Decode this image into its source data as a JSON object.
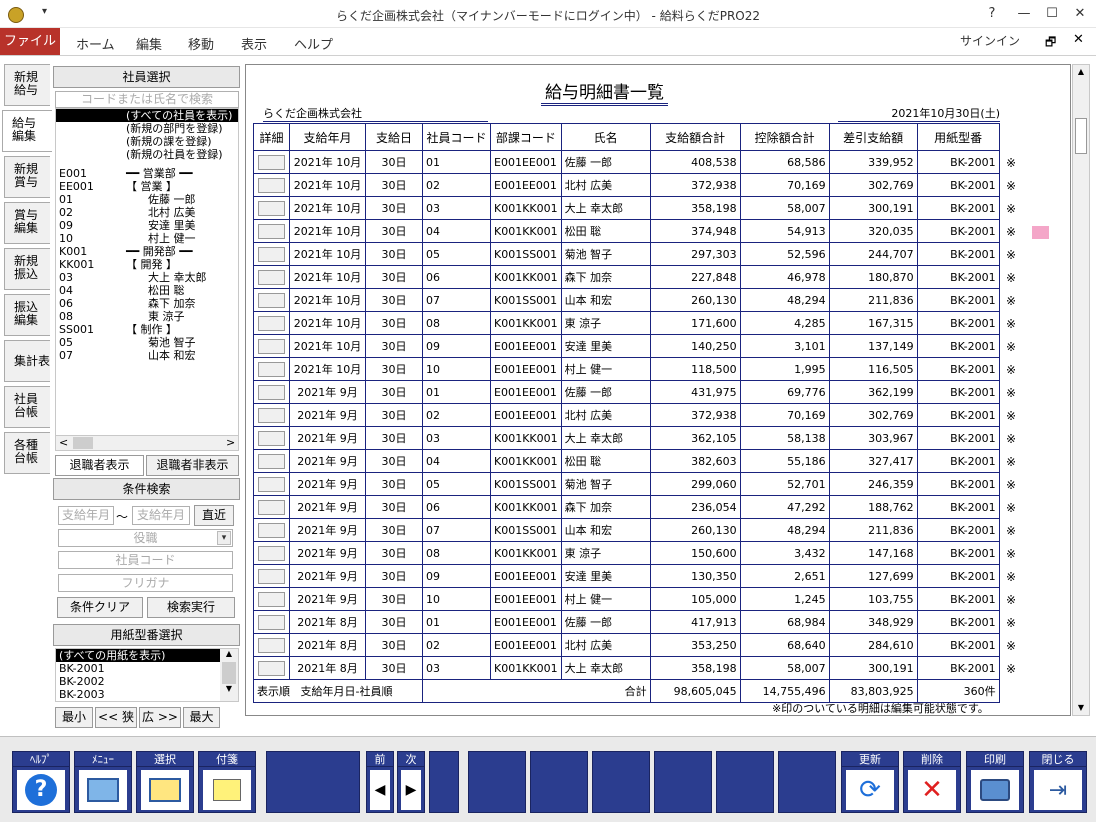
{
  "window": {
    "title": "らくだ企画株式会社（マイナンバーモードにログイン中） - 給料らくだPRO22",
    "qat": "▾",
    "help": "?",
    "minimize": "—",
    "maximize": "☐",
    "close": "✕"
  },
  "ribbon": {
    "file": "ファイル",
    "tabs": [
      "ホーム",
      "編集",
      "移動",
      "表示",
      "ヘルプ"
    ],
    "signin": "サインイン",
    "restore": "🗗",
    "close2": "✕"
  },
  "vtabs": [
    [
      "新規",
      "給与"
    ],
    [
      "給与",
      "編集"
    ],
    [
      "新規",
      "賞与"
    ],
    [
      "賞与",
      "編集"
    ],
    [
      "新規",
      "振込"
    ],
    [
      "振込",
      "編集"
    ],
    [
      "集計表",
      ""
    ],
    [
      "社員",
      "台帳"
    ],
    [
      "各種",
      "台帳"
    ]
  ],
  "emp": {
    "header": "社員選択",
    "search_placeholder": "コードまたは氏名で検索",
    "tree": [
      [
        "",
        "(すべての社員を表示)"
      ],
      [
        "",
        "(新規の部門を登録)"
      ],
      [
        "",
        "(新規の課を登録)"
      ],
      [
        "",
        "(新規の社員を登録)"
      ],
      [
        "E001",
        "━━ 営業部 ━━"
      ],
      [
        "EE001",
        "【 営業 】"
      ],
      [
        "01",
        "　　佐藤 一郎"
      ],
      [
        "02",
        "　　北村 広美"
      ],
      [
        "09",
        "　　安達 里美"
      ],
      [
        "10",
        "　　村上 健一"
      ],
      [
        "K001",
        "━━ 開発部 ━━"
      ],
      [
        "KK001",
        "【 開発 】"
      ],
      [
        "03",
        "　　大上 幸太郎"
      ],
      [
        "04",
        "　　松田 聡"
      ],
      [
        "06",
        "　　森下 加奈"
      ],
      [
        "08",
        "　　東 涼子"
      ],
      [
        "SS001",
        "【 制作 】"
      ],
      [
        "05",
        "　　菊池 智子"
      ],
      [
        "07",
        "　　山本 和宏"
      ]
    ],
    "retired_show": "退職者表示",
    "retired_hide": "退職者非表示",
    "cond_header": "条件検索",
    "pay_ym_from": "支給年月",
    "tilde": "～",
    "pay_ym_to": "支給年月",
    "recent": "直近",
    "position": "役職",
    "emp_code": "社員コード",
    "furigana": "フリガナ",
    "clear": "条件クリア",
    "exec": "検索実行",
    "paper_header": "用紙型番選択",
    "papers": [
      "(すべての用紙を表示)",
      "BK-2001",
      "BK-2002",
      "BK-2003"
    ],
    "nav": [
      "最小",
      "<< 狭",
      "広 >>",
      "最大"
    ]
  },
  "main": {
    "title": "給与明細書一覧",
    "company": "らくだ企画株式会社",
    "date": "2021年10月30日(土)",
    "columns": [
      "詳細",
      "支給年月",
      "支給日",
      "社員コード",
      "部課コード",
      "氏名",
      "支給額合計",
      "控除額合計",
      "差引支給額",
      "用紙型番"
    ],
    "rows": [
      [
        "2021年 10月",
        "30日",
        "01",
        "E001EE001",
        "佐藤 一郎",
        "408,538",
        "68,586",
        "339,952",
        "BK-2001"
      ],
      [
        "2021年 10月",
        "30日",
        "02",
        "E001EE001",
        "北村 広美",
        "372,938",
        "70,169",
        "302,769",
        "BK-2001"
      ],
      [
        "2021年 10月",
        "30日",
        "03",
        "K001KK001",
        "大上 幸太郎",
        "358,198",
        "58,007",
        "300,191",
        "BK-2001"
      ],
      [
        "2021年 10月",
        "30日",
        "04",
        "K001KK001",
        "松田 聡",
        "374,948",
        "54,913",
        "320,035",
        "BK-2001"
      ],
      [
        "2021年 10月",
        "30日",
        "05",
        "K001SS001",
        "菊池 智子",
        "297,303",
        "52,596",
        "244,707",
        "BK-2001"
      ],
      [
        "2021年 10月",
        "30日",
        "06",
        "K001KK001",
        "森下 加奈",
        "227,848",
        "46,978",
        "180,870",
        "BK-2001"
      ],
      [
        "2021年 10月",
        "30日",
        "07",
        "K001SS001",
        "山本 和宏",
        "260,130",
        "48,294",
        "211,836",
        "BK-2001"
      ],
      [
        "2021年 10月",
        "30日",
        "08",
        "K001KK001",
        "東 涼子",
        "171,600",
        "4,285",
        "167,315",
        "BK-2001"
      ],
      [
        "2021年 10月",
        "30日",
        "09",
        "E001EE001",
        "安達 里美",
        "140,250",
        "3,101",
        "137,149",
        "BK-2001"
      ],
      [
        "2021年 10月",
        "30日",
        "10",
        "E001EE001",
        "村上 健一",
        "118,500",
        "1,995",
        "116,505",
        "BK-2001"
      ],
      [
        "2021年 9月",
        "30日",
        "01",
        "E001EE001",
        "佐藤 一郎",
        "431,975",
        "69,776",
        "362,199",
        "BK-2001"
      ],
      [
        "2021年 9月",
        "30日",
        "02",
        "E001EE001",
        "北村 広美",
        "372,938",
        "70,169",
        "302,769",
        "BK-2001"
      ],
      [
        "2021年 9月",
        "30日",
        "03",
        "K001KK001",
        "大上 幸太郎",
        "362,105",
        "58,138",
        "303,967",
        "BK-2001"
      ],
      [
        "2021年 9月",
        "30日",
        "04",
        "K001KK001",
        "松田 聡",
        "382,603",
        "55,186",
        "327,417",
        "BK-2001"
      ],
      [
        "2021年 9月",
        "30日",
        "05",
        "K001SS001",
        "菊池 智子",
        "299,060",
        "52,701",
        "246,359",
        "BK-2001"
      ],
      [
        "2021年 9月",
        "30日",
        "06",
        "K001KK001",
        "森下 加奈",
        "236,054",
        "47,292",
        "188,762",
        "BK-2001"
      ],
      [
        "2021年 9月",
        "30日",
        "07",
        "K001SS001",
        "山本 和宏",
        "260,130",
        "48,294",
        "211,836",
        "BK-2001"
      ],
      [
        "2021年 9月",
        "30日",
        "08",
        "K001KK001",
        "東 涼子",
        "150,600",
        "3,432",
        "147,168",
        "BK-2001"
      ],
      [
        "2021年 9月",
        "30日",
        "09",
        "E001EE001",
        "安達 里美",
        "130,350",
        "2,651",
        "127,699",
        "BK-2001"
      ],
      [
        "2021年 9月",
        "30日",
        "10",
        "E001EE001",
        "村上 健一",
        "105,000",
        "1,245",
        "103,755",
        "BK-2001"
      ],
      [
        "2021年 8月",
        "30日",
        "01",
        "E001EE001",
        "佐藤 一郎",
        "417,913",
        "68,984",
        "348,929",
        "BK-2001"
      ],
      [
        "2021年 8月",
        "30日",
        "02",
        "E001EE001",
        "北村 広美",
        "353,250",
        "68,640",
        "284,610",
        "BK-2001"
      ],
      [
        "2021年 8月",
        "30日",
        "03",
        "K001KK001",
        "大上 幸太郎",
        "358,198",
        "58,007",
        "300,191",
        "BK-2001"
      ]
    ],
    "edit_mark": "※",
    "footer": {
      "order_label": "表示順",
      "order_value": "支給年月日-社員順",
      "total_label": "合計",
      "total_pay": "98,605,045",
      "total_ded": "14,755,496",
      "total_net": "83,803,925",
      "count": "360件"
    },
    "note": "※印のついている明細は編集可能状態です。"
  },
  "toolbar": {
    "help": "ﾍﾙﾌﾟ",
    "menu": "ﾒﾆｭｰ",
    "select": "選択",
    "tag": "付箋",
    "prev": "前",
    "next": "次",
    "update": "更新",
    "delete": "削除",
    "print": "印刷",
    "close": "閉じる"
  }
}
